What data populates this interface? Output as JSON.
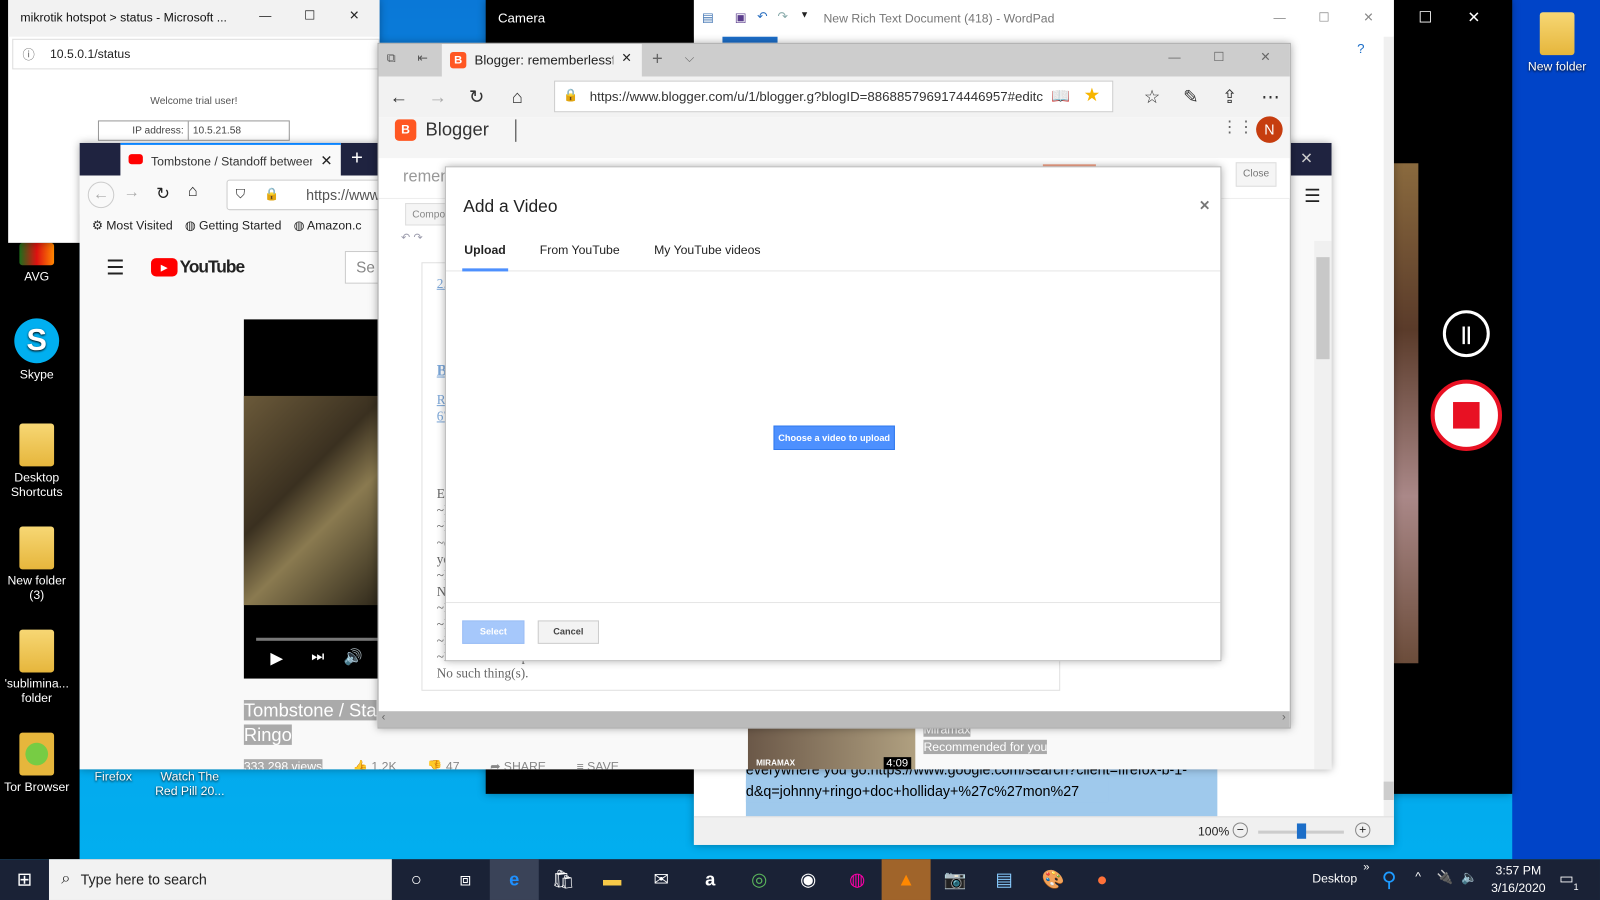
{
  "desktop": {
    "icons_left": [
      {
        "label": "AVG",
        "icon": "avg-icon"
      },
      {
        "label": "Skype",
        "icon": "skype-icon"
      },
      {
        "label": "Desktop Shortcuts",
        "icon": "folder-icon"
      },
      {
        "label": "New folder (3)",
        "icon": "folder-icon"
      },
      {
        "label": "'sublimina... folder",
        "icon": "folder-icon"
      },
      {
        "label": "Tor Browser",
        "icon": "tor-folder-icon"
      }
    ],
    "icons_bottom": [
      {
        "label": "Firefox",
        "icon": "firefox-icon"
      },
      {
        "label": "Watch The Red Pill 20...",
        "icon": "video-file-icon"
      }
    ],
    "icon_right": {
      "label": "New folder",
      "icon": "folder-icon"
    }
  },
  "camera": {
    "title": "Camera",
    "pause": "pause-icon",
    "stop": "stop-icon",
    "accent": "#e81123"
  },
  "wordpad": {
    "title": "New Rich Text Document (418) - WordPad",
    "selected_text_1": "everywhere you go.https://www.google.com/search?client=firefox-b-1-",
    "selected_text_2": "d&q=johnny+ringo+doc+holliday+%27c%27mon%27",
    "zoom": "100%",
    "zoom_level": 100
  },
  "mikrotik": {
    "title": "mikrotik hotspot > status - Microsoft ...",
    "url": "10.5.0.1/status",
    "welcome": "Welcome trial user!",
    "ip_label": "IP address:",
    "ip_value": "10.5.21.58"
  },
  "firefox": {
    "tab_title": "Tombstone / Standoff between",
    "url": "https://www",
    "bookmarks": [
      "Most Visited",
      "Getting Started",
      "Amazon.c"
    ],
    "youtube": {
      "logo": "YouTube",
      "search_placeholder": "Se",
      "video_title_1": "Tombstone / Sta",
      "video_title_2": "Ringo",
      "views": "333,298 views",
      "likes": "1.2K",
      "dislikes": "47",
      "share": "SHARE",
      "save": "SAVE",
      "rec_channel": "Miramax",
      "rec_label": "Recommended for you",
      "rec_duration": "4:09",
      "rec_watermark": "MIRAMAX"
    }
  },
  "edge": {
    "tab_title": "Blogger: rememberlessf",
    "url": "https://www.blogger.com/u/1/blogger.g?blogID=8868857969174446957#editc",
    "blogger": {
      "logo": "Blogger",
      "avatar": "N",
      "blog_name": "remem",
      "compose": "Compo",
      "close_btn": "Close",
      "editor_lines": [
        "2.",
        "B",
        "R",
        "67"
      ],
      "body_lines": [
        "Ev",
        "~I",
        "~I",
        "~c",
        "ye",
        "~I",
        "N",
        "~I",
        "~I",
        "~I",
        "~Nathaniel Joseph Carlson",
        "No such thing(s)."
      ]
    }
  },
  "dialog": {
    "title": "Add a Video",
    "tabs": [
      {
        "label": "Upload",
        "active": true
      },
      {
        "label": "From YouTube",
        "active": false
      },
      {
        "label": "My YouTube videos",
        "active": false
      }
    ],
    "upload_button": "Choose a video to upload",
    "select": "Select",
    "cancel": "Cancel",
    "accent": "#4d90fe"
  },
  "taskbar": {
    "search_placeholder": "Type here to search",
    "desktop_label": "Desktop",
    "time": "3:57 PM",
    "date": "3/16/2020",
    "notification_count": "1"
  }
}
